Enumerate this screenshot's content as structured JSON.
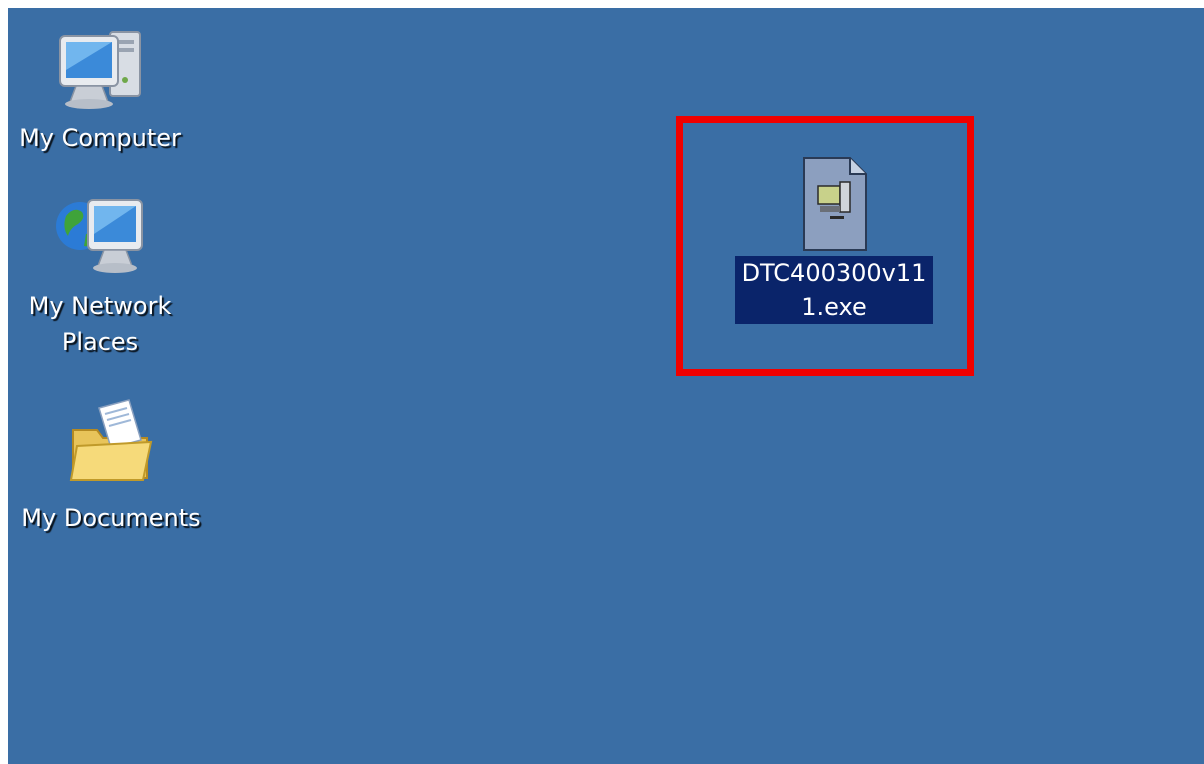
{
  "desktop": {
    "background_color": "#3a6ea5",
    "icons": [
      {
        "name": "my-computer",
        "label": "My Computer",
        "icon": "computer-icon"
      },
      {
        "name": "my-network-places",
        "label": "My Network\nPlaces",
        "icon": "network-globe-icon"
      },
      {
        "name": "my-documents",
        "label": "My Documents",
        "icon": "folder-documents-icon"
      }
    ],
    "selected_file": {
      "label": "DTC400300v111.exe",
      "icon": "installer-exe-icon",
      "selected": true,
      "selection_color": "#0a246a",
      "highlight_box_color": "#f00000"
    }
  }
}
